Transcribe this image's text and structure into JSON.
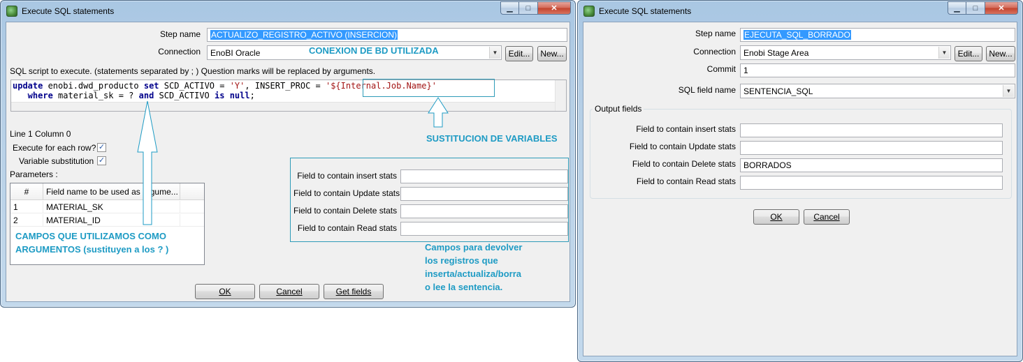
{
  "left": {
    "title": "Execute SQL statements",
    "step_name_label": "Step name",
    "step_name_value": "ACTUALIZO_REGISTRO_ACTIVO (INSERCION)",
    "connection_label": "Connection",
    "connection_value": "EnoBI Oracle",
    "edit_button": "Edit...",
    "new_button": "New...",
    "sql_hint": "SQL script to execute. (statements separated by ; ) Question marks will be replaced by arguments.",
    "sql": {
      "l1_kw1": "update",
      "l1_t1": " enobi.dwd_producto ",
      "l1_kw2": "set",
      "l1_t2": " SCD_ACTIVO = ",
      "l1_s1": "'Y'",
      "l1_t3": ", INSERT_PROC = ",
      "l1_s2": "'${Internal.Job.Name}'",
      "l2_kw1": "   where",
      "l2_t1": " material_sk = ? ",
      "l2_kw2": "and",
      "l2_t2": " SCD_ACTIVO ",
      "l2_kw3": "is null",
      "l2_t3": ";"
    },
    "position": "Line 1 Column 0",
    "exec_each_row_label": "Execute for each row?",
    "variable_subst_label": "Variable substitution",
    "parameters_label": "Parameters :",
    "table": {
      "col_num": "#",
      "col_field": "Field name to be used as argume...",
      "rows": [
        {
          "n": "1",
          "field": "MATERIAL_SK"
        },
        {
          "n": "2",
          "field": "MATERIAL_ID"
        }
      ]
    },
    "stats": {
      "insert": "Field to contain insert stats",
      "update": "Field to contain Update stats",
      "delete": "Field to contain Delete stats",
      "read": "Field to contain Read stats"
    },
    "ok_button": "OK",
    "cancel_button": "Cancel",
    "getfields_button": "Get fields",
    "annotations": {
      "connection": "CONEXION DE BD UTILIZADA",
      "variables": "SUSTITUCION DE VARIABLES",
      "args_line1": "CAMPOS QUE UTILIZAMOS COMO",
      "args_line2": "ARGUMENTOS (sustituyen a los ? )",
      "stats_line1": "Campos para devolver",
      "stats_line2": "los registros que",
      "stats_line3": "inserta/actualiza/borra",
      "stats_line4": "o lee la sentencia."
    }
  },
  "right": {
    "title": "Execute SQL statements",
    "step_name_label": "Step name",
    "step_name_value": "EJECUTA_SQL_BORRADO",
    "connection_label": "Connection",
    "connection_value": "Enobi Stage Area",
    "edit_button": "Edit...",
    "new_button": "New...",
    "commit_label": "Commit",
    "commit_value": "1",
    "sql_field_label": "SQL field name",
    "sql_field_value": "SENTENCIA_SQL",
    "output_fields_label": "Output fields",
    "stats": {
      "insert": "Field to contain insert stats",
      "update": "Field to contain Update stats",
      "delete": "Field to contain Delete stats",
      "delete_value": "BORRADOS",
      "read": "Field to contain Read stats"
    },
    "ok_button": "OK",
    "cancel_button": "Cancel"
  },
  "colors": {
    "annotation": "#1e9bc4",
    "selection": "#3399ff",
    "keyword": "#00008b",
    "string": "#a31515"
  }
}
